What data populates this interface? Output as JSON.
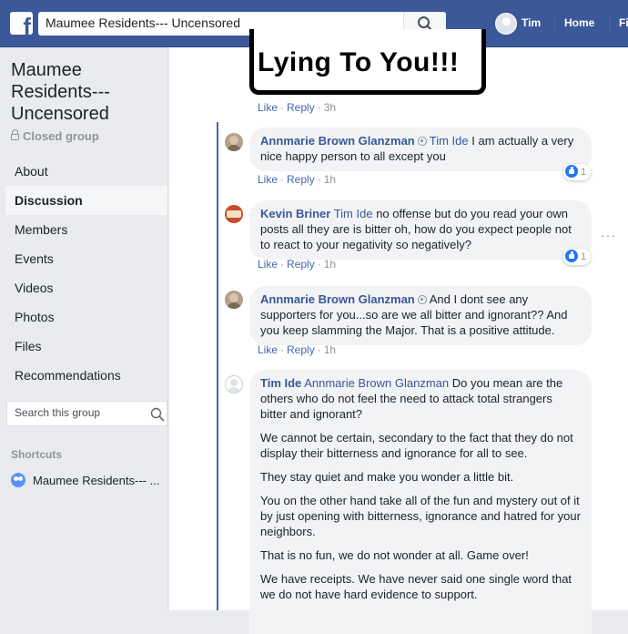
{
  "topbar": {
    "search_value": "Maumee Residents--- Uncensored",
    "user_name": "Tim",
    "home_label": "Home",
    "find_label": "Fi"
  },
  "sidebar": {
    "group_title": "Maumee Residents--- Uncensored",
    "privacy": "Closed group",
    "nav": [
      "About",
      "Discussion",
      "Members",
      "Events",
      "Videos",
      "Photos",
      "Files",
      "Recommendations"
    ],
    "active_nav": "Discussion",
    "search_placeholder": "Search this group",
    "shortcuts_heading": "Shortcuts",
    "shortcut_item": "Maumee Residents--- ..."
  },
  "post": {
    "image_text": "Lying To You!!!",
    "actions": {
      "like": "Like",
      "reply": "Reply",
      "time": "3h"
    }
  },
  "replies": [
    {
      "author": "Annmarie Brown Glanzman",
      "mention": "Tim Ide",
      "text": "I am actually a very nice happy person to all except you",
      "like": "Like",
      "reply": "Reply",
      "time": "1h",
      "likes": "1"
    },
    {
      "author": "Kevin Briner",
      "mention": "Tim Ide",
      "text": "no offense but do you read your own posts all they are is bitter oh, how do you expect people not to react to your negativity so negatively?",
      "like": "Like",
      "reply": "Reply",
      "time": "1h",
      "likes": "1"
    },
    {
      "author": "Annmarie Brown Glanzman",
      "text": "And I dont see any supporters for you...so are we all bitter and ignorant?? And you keep slamming the Major. That is a positive attitude.",
      "like": "Like",
      "reply": "Reply",
      "time": "1h"
    },
    {
      "author": "Tim Ide",
      "mention": "Annmarie Brown Glanzman",
      "text": "Do you mean are the others who do not feel the need to attack total strangers bitter and ignorant?",
      "paragraphs": [
        "We cannot be certain, secondary to the fact that they do not display their bitterness and ignorance for all to see.",
        "They stay quiet and make you wonder a little bit.",
        "You on the other hand take all of the fun and mystery out of it by just opening with bitterness, ignorance and hatred for your neighbors.",
        "That is no fun, we do not wonder at all. Game over!",
        "We have receipts. We have never said one single word that we do not have hard evidence to support."
      ]
    }
  ],
  "colors": {
    "brand": "#3b5998",
    "link": "#385898",
    "bubble": "#f2f3f5",
    "thread_line": "#4267b2"
  }
}
